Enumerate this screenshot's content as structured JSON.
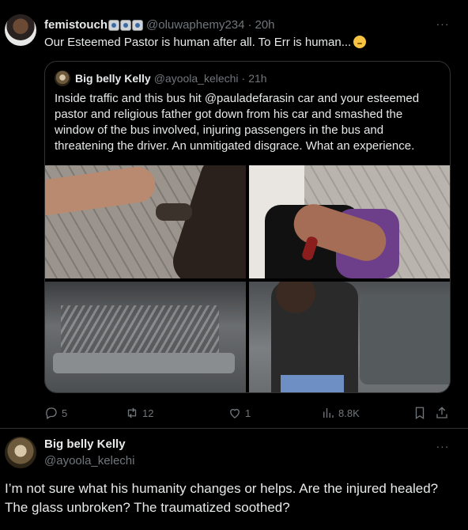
{
  "tweet": {
    "author_name": "femistouch",
    "author_handle": "@oluwaphemy234",
    "time": "20h",
    "text": "Our Esteemed Pastor is human after all. To Err is human...",
    "name_emojis": [
      "camera-flash-emoji",
      "camera-flash-emoji",
      "camera-flash-emoji"
    ],
    "trailing_emoji": "face-with-hand-over-mouth-emoji"
  },
  "quote": {
    "author_name": "Big belly Kelly",
    "author_handle": "@ayoola_kelechi",
    "time": "21h",
    "text": "Inside traffic and this bus hit  @pauladefarasin car and your esteemed pastor and religious father got down from his car and smashed the window of the bus involved, injuring passengers in the bus and threatening the driver. An unmitigated disgrace. What an experience."
  },
  "stats": {
    "replies": "5",
    "reposts": "12",
    "likes": "1",
    "views": "8.8K"
  },
  "reply": {
    "author_name": "Big belly Kelly",
    "author_handle": "@ayoola_kelechi",
    "text": "I’m not sure what his humanity changes or helps. Are the injured healed? The glass unbroken? The traumatized soothed?"
  },
  "colors": {
    "background": "#000000",
    "text": "#e7e9ea",
    "muted": "#71767b",
    "border": "#2f3336"
  },
  "icons": [
    "more-icon",
    "reply-icon",
    "repost-icon",
    "like-icon",
    "views-icon",
    "bookmark-icon",
    "share-icon"
  ]
}
